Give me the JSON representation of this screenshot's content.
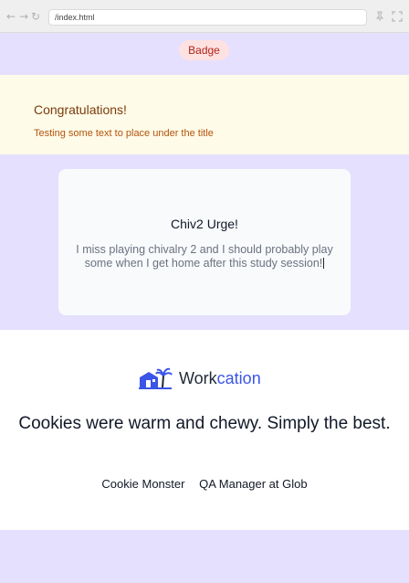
{
  "browser": {
    "url": "/index.html",
    "back_icon": "back-arrow-icon",
    "forward_icon": "forward-arrow-icon",
    "reload_icon": "reload-icon",
    "pin_icon": "pin-icon",
    "fullscreen_icon": "fullscreen-icon"
  },
  "badge": {
    "label": "Badge",
    "colors": {
      "bg": "#fde2e1",
      "text": "#b42318"
    }
  },
  "alert": {
    "title": "Congratulations!",
    "text": "Testing some text to place under the title",
    "colors": {
      "bg": "#fefbe8",
      "title": "#7a3b0c",
      "text": "#b4530b"
    }
  },
  "card": {
    "title": "Chiv2 Urge!",
    "text": "I miss playing chivalry 2 and I should probably play some when I get home after this study session!"
  },
  "testimonial": {
    "logo": {
      "text_dark": "Work",
      "text_accent": "cation",
      "icon": "house-palm-logo-icon",
      "accent_color": "#3b55e6"
    },
    "quote": "Cookies were warm and chewy. Simply the best.",
    "author_name": "Cookie Monster",
    "author_role": "QA Manager at Glob"
  },
  "colors": {
    "page_bg": "#e5e0fd"
  }
}
